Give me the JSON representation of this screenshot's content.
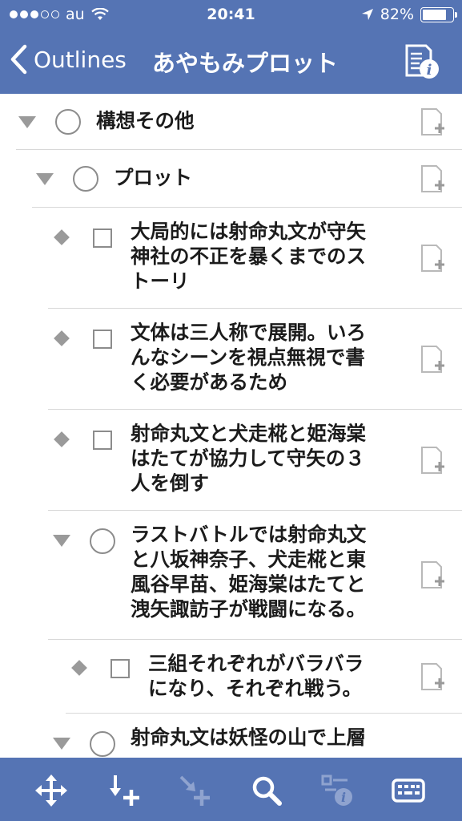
{
  "status": {
    "carrier": "au",
    "time": "20:41",
    "battery": "82%"
  },
  "nav": {
    "back_label": "Outlines",
    "title": "あやもみプロット"
  },
  "outline": {
    "rows": [
      {
        "lines": [
          "構想その他"
        ]
      },
      {
        "lines": [
          "プロット"
        ]
      },
      {
        "lines": [
          "大局的には射命丸文が守矢",
          "神社の不正を暴くまでのス",
          "トーリ"
        ]
      },
      {
        "lines": [
          "文体は三人称で展開。いろ",
          "んなシーンを視点無視で書",
          "く必要があるため"
        ]
      },
      {
        "lines": [
          "射命丸文と犬走椛と姫海棠",
          "はたてが協力して守矢の３",
          "人を倒す"
        ]
      },
      {
        "lines": [
          "ラストバトルでは射命丸文",
          "と八坂神奈子、犬走椛と東",
          "風谷早苗、姫海棠はたてと",
          "洩矢諏訪子が戦闘になる。"
        ]
      },
      {
        "lines": [
          "三組それぞれがバラバラ",
          "になり、それぞれ戦う。"
        ]
      },
      {
        "lines": [
          "射命丸文は妖怪の山で上層"
        ]
      }
    ]
  },
  "colors": {
    "bar": "#5574b4",
    "icon_gray": "#9a9a9a"
  }
}
